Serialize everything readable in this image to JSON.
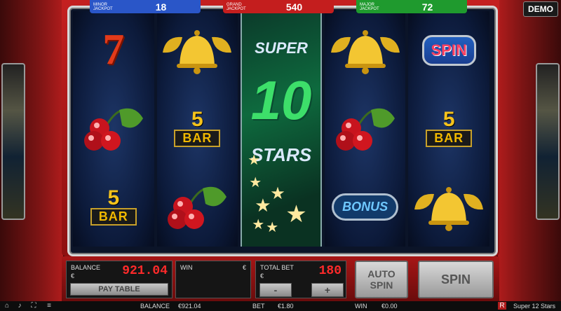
{
  "jackpots": [
    {
      "label": "MINOR JACKPOT",
      "value": "18",
      "color": "#2a56c8"
    },
    {
      "label": "GRAND JACKPOT",
      "value": "540",
      "color": "#c41e1e"
    },
    {
      "label": "MAJOR JACKPOT",
      "value": "72",
      "color": "#1f9a2e"
    }
  ],
  "mode_badge": "DEMO",
  "reels": [
    [
      "seven",
      "cherries",
      "5bar"
    ],
    [
      "bell",
      "5bar",
      "cherries"
    ],
    [
      "wild"
    ],
    [
      "bell",
      "cherries",
      "bonus"
    ],
    [
      "spin",
      "5bar",
      "bell"
    ]
  ],
  "symbols": {
    "five": "5",
    "bar": "BAR",
    "spin": "SPIN",
    "bonus": "BONUS",
    "seven": "7"
  },
  "wild": {
    "line1": "SUPER",
    "line2": "10",
    "line3": "STARS"
  },
  "controls": {
    "balance_label": "BALANCE",
    "balance_value": "921.04",
    "win_label": "WIN",
    "total_bet_label": "TOTAL BET",
    "total_bet_value": "180",
    "paytable_label": "PAY TABLE",
    "minus_label": "-",
    "plus_label": "+",
    "autospin_label": "AUTO SPIN",
    "spin_label": "SPIN",
    "currency_symbol": "€"
  },
  "status_bar": {
    "balance_label": "BALANCE",
    "balance_value": "€921.04",
    "bet_label": "BET",
    "bet_value": "€1.80",
    "win_label": "WIN",
    "win_value": "€0.00",
    "game_title": "Super 12 Stars"
  }
}
